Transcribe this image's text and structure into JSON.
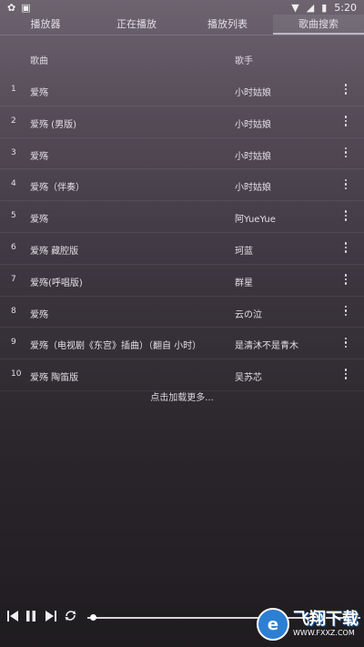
{
  "status_bar": {
    "left_icons": [
      "app-icon",
      "notification-icon"
    ],
    "right_icons": [
      "wifi-icon",
      "signal-icon",
      "battery-icon"
    ],
    "time": "5:20"
  },
  "tabs": [
    {
      "label": "播放器"
    },
    {
      "label": "正在播放"
    },
    {
      "label": "播放列表"
    },
    {
      "label": "歌曲搜索",
      "active": true
    }
  ],
  "list": {
    "header": {
      "title": "歌曲",
      "artist": "歌手"
    },
    "rows": [
      {
        "num": "1",
        "title": "爱殇",
        "artist": "小时姑娘"
      },
      {
        "num": "2",
        "title": "爱殇 (男版)",
        "artist": "小时姑娘"
      },
      {
        "num": "3",
        "title": "爱殇",
        "artist": "小时姑娘"
      },
      {
        "num": "4",
        "title": "爱殇（伴奏）",
        "artist": "小时姑娘"
      },
      {
        "num": "5",
        "title": "爱殇",
        "artist": "阿YueYue"
      },
      {
        "num": "6",
        "title": "爱殇 藏腔版",
        "artist": "珂蓝"
      },
      {
        "num": "7",
        "title": "爱殇(呼唱版)",
        "artist": "群星"
      },
      {
        "num": "8",
        "title": "爱殇",
        "artist": "云の泣"
      },
      {
        "num": "9",
        "title": "爱殇（电视剧《东宫》插曲）（翻自 小时）",
        "artist": "是清沐不是青木"
      },
      {
        "num": "10",
        "title": "爱殇 陶笛版",
        "artist": "吴苏芯"
      }
    ],
    "load_more": "点击加载更多..."
  },
  "player": {
    "controls": [
      "previous-icon",
      "pause-icon",
      "next-icon",
      "repeat-icon"
    ],
    "progress": 0.02
  },
  "watermark": {
    "main": "飞翔下载",
    "sub": "WWW.FXXZ.COM"
  }
}
